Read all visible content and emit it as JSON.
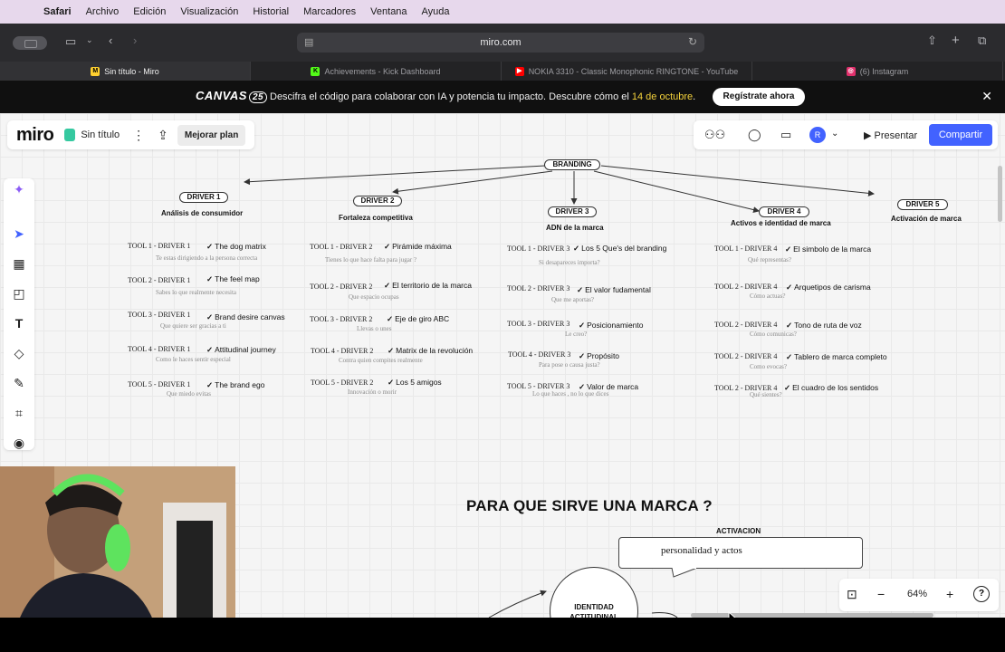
{
  "menubar": {
    "apple": "",
    "items": [
      "Safari",
      "Archivo",
      "Edición",
      "Visualización",
      "Historial",
      "Marcadores",
      "Ventana",
      "Ayuda"
    ]
  },
  "browser": {
    "address": "miro.com",
    "tabs": [
      {
        "label": "Sin título - Miro",
        "favicon_color": "#ffd02f",
        "favicon": "M"
      },
      {
        "label": "Achievements - Kick Dashboard",
        "favicon_color": "#53fc18",
        "favicon": "K"
      },
      {
        "label": "NOKIA 3310 - Classic Monophonic RINGTONE - YouTube",
        "favicon_color": "#ff0000",
        "favicon": "▶"
      },
      {
        "label": "(6) Instagram",
        "favicon_color": "#e1306c",
        "favicon": "◎"
      }
    ]
  },
  "banner": {
    "logo": "CANVAS",
    "logo_num": "25",
    "message_prefix": "Descifra el código para colaborar con IA y potencia tu impacto. Descubre cómo el ",
    "message_highlight": "14 de octubre",
    "message_suffix": ".",
    "cta": "Regístrate ahora",
    "close": "✕"
  },
  "board": {
    "logo": "miro",
    "title": "Sin título",
    "more": "⋮",
    "upgrade": "Mejorar plan",
    "present": "▶  Presentar",
    "share": "Compartir",
    "avatar": "R"
  },
  "diagram": {
    "root": "BRANDING",
    "drivers": [
      {
        "label": "DRIVER 1",
        "subtitle": "Análisis de consumidor"
      },
      {
        "label": "DRIVER 2",
        "subtitle": "Fortaleza competitiva"
      },
      {
        "label": "DRIVER 3",
        "subtitle": "ADN de la marca"
      },
      {
        "label": "DRIVER 4",
        "subtitle": "Activos e identidad de marca"
      },
      {
        "label": "DRIVER 5",
        "subtitle": "Activación de marca"
      }
    ],
    "columns": [
      [
        {
          "tool": "TOOL 1 - DRIVER 1",
          "name": "The dog matrix",
          "desc": "Te estas dirigiendo a la persona correcta"
        },
        {
          "tool": "TOOL 2 - DRIVER 1",
          "name": "The feel map",
          "desc": "Sabes lo que realmente necesita"
        },
        {
          "tool": "TOOL 3 - DRIVER 1",
          "name": "Brand desire canvas",
          "desc": "Que quiere ser gracias a ti"
        },
        {
          "tool": "TOOL 4 - DRIVER 1",
          "name": "Attitudinal journey",
          "desc": "Como le haces sentir especial"
        },
        {
          "tool": "TOOL 5 - DRIVER 1",
          "name": "The brand ego",
          "desc": "Que miedo evitas"
        }
      ],
      [
        {
          "tool": "TOOL 1 - DRIVER 2",
          "name": "Pirámide máxima",
          "desc": "Tienes lo que hace falta para jugar ?"
        },
        {
          "tool": "TOOL 2 - DRIVER 2",
          "name": "El territorio de la marca",
          "desc": "Que espacio ocupas"
        },
        {
          "tool": "TOOL 3 - DRIVER 2",
          "name": "Eje de giro ABC",
          "desc": "Llevas o unes"
        },
        {
          "tool": "TOOL 4 - DRIVER 2",
          "name": "Matrix de la revolución",
          "desc": "Contra quien compites realmente"
        },
        {
          "tool": "TOOL 5 - DRIVER 2",
          "name": "Los 5 amigos",
          "desc": "Innovación o morir"
        }
      ],
      [
        {
          "tool": "TOOL 1 - DRIVER 3",
          "name": "Los 5 Que's del branding",
          "desc": "Si desapareces importa?"
        },
        {
          "tool": "TOOL 2 - DRIVER 3",
          "name": "El valor fudamental",
          "desc": "Que me aportas?"
        },
        {
          "tool": "TOOL 3 - DRIVER 3",
          "name": "Posicionamiento",
          "desc": "Le creo?"
        },
        {
          "tool": "TOOL 4 - DRIVER 3",
          "name": "Propósito",
          "desc": "Para pose o causa justa?"
        },
        {
          "tool": "TOOL 5 - DRIVER 3",
          "name": "Valor de marca",
          "desc": "Lo que haces , no lo que dices"
        }
      ],
      [
        {
          "tool": "TOOL 1 - DRIVER 4",
          "name": "El simbolo de la marca",
          "desc": "Qué representas?"
        },
        {
          "tool": "TOOL 2 - DRIVER 4",
          "name": "Arquetipos de carisma",
          "desc": "Cómo actuas?"
        },
        {
          "tool": "TOOL 2 - DRIVER 4",
          "name": "Tono de ruta de voz",
          "desc": "Cómo comunicas?"
        },
        {
          "tool": "TOOL 2 - DRIVER 4",
          "name": "Tablero de marca completo",
          "desc": "Como evocas?"
        },
        {
          "tool": "TOOL 2 - DRIVER 4",
          "name": "El cuadro de los sentidos",
          "desc": "Qué sientes?"
        }
      ]
    ],
    "section_title": "PARA QUE SIRVE UNA MARCA ?",
    "activation_label": "ACTIVACION",
    "bubble_text": "personalidad y actos",
    "circle_text": "IDENTIDAD ACTITUDINAL"
  },
  "controls": {
    "zoom": "64%",
    "minus": "−",
    "plus": "+",
    "help": "?"
  }
}
